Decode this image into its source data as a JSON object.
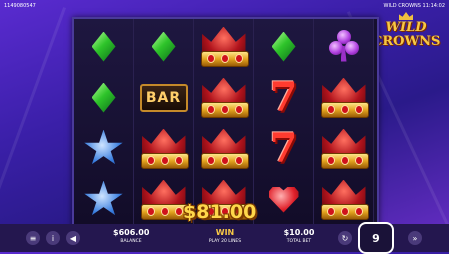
{
  "topbar": {
    "session_id": "1149080547",
    "game_time": "WILD CROWNS 11:14:02"
  },
  "logo": {
    "line1": "WILD",
    "line2": "CROWNS"
  },
  "reels": [
    [
      "gem-green",
      "gem-green",
      "star",
      "star"
    ],
    [
      "gem-green",
      "bar",
      "crown",
      "crown"
    ],
    [
      "crown",
      "crown",
      "crown",
      "crown"
    ],
    [
      "gem-green",
      "seven",
      "seven",
      "heart"
    ],
    [
      "club",
      "crown",
      "crown",
      "crown"
    ]
  ],
  "symbols": {
    "bar_text": "BAR",
    "seven_text": "7"
  },
  "win_overlay": {
    "amount": "$81.00"
  },
  "bottom": {
    "balance_value": "$606.00",
    "balance_label": "BALANCE",
    "win_label": "WIN",
    "lines_label": "PLAY 20 LINES",
    "bet_value": "$10.00",
    "bet_label": "TOTAL BET",
    "spin_count": "9"
  },
  "icons": [
    "menu-icon",
    "info-icon",
    "sound-icon",
    "autoplay-icon",
    "turbo-icon"
  ],
  "colors": {
    "accent": "#f7c845",
    "frame": "#4a3a9a",
    "background": "#3a1fa8"
  }
}
